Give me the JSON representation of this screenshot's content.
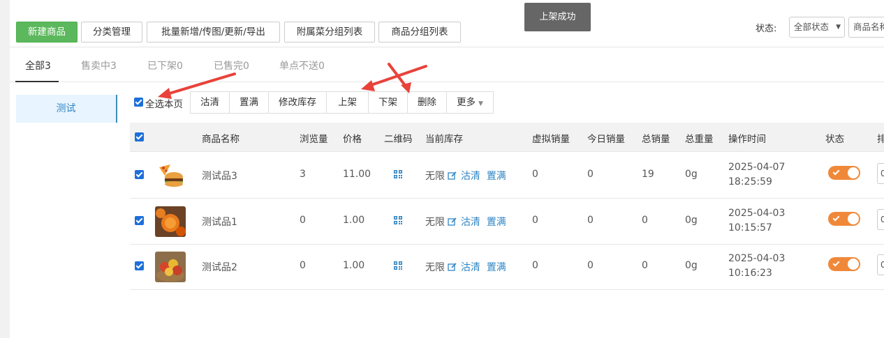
{
  "toolbar": {
    "new_product": "新建商品",
    "category_manage": "分类管理",
    "batch_ops": "批量新增/传图/更新/导出",
    "addon_group_list": "附属菜分组列表",
    "product_group_list": "商品分组列表",
    "status_label": "状态:",
    "status_select": "全部状态",
    "name_select": "商品名称"
  },
  "toast": "上架成功",
  "tabs": [
    {
      "label": "全部3"
    },
    {
      "label": "售卖中3"
    },
    {
      "label": "已下架0"
    },
    {
      "label": "已售完0"
    },
    {
      "label": "单点不送0"
    }
  ],
  "sidebar": {
    "category": "测试"
  },
  "actions": {
    "select_page": "全选本页",
    "items": [
      "沽清",
      "置满",
      "修改库存",
      "上架",
      "下架",
      "删除",
      "更多"
    ]
  },
  "table": {
    "headers": {
      "name": "商品名称",
      "views": "浏览量",
      "price": "价格",
      "qrcode": "二维码",
      "stock": "当前库存",
      "virtual_sales": "虚拟销量",
      "today_sales": "今日销量",
      "total_sales": "总销量",
      "total_weight": "总重量",
      "op_time": "操作时间",
      "status": "状态",
      "sort": "排"
    },
    "stock_text": "无限",
    "clear_link": "沽清",
    "fill_link": "置满",
    "rows": [
      {
        "name": "测试品3",
        "views": "3",
        "price": "11.00",
        "virtual": "0",
        "today": "0",
        "total": "19",
        "weight": "0g",
        "date": "2025-04-07",
        "time": "18:25:59",
        "sort": "0",
        "image": "pizza-burger"
      },
      {
        "name": "测试品1",
        "views": "0",
        "price": "1.00",
        "virtual": "0",
        "today": "0",
        "total": "0",
        "weight": "0g",
        "date": "2025-04-03",
        "time": "10:15:57",
        "sort": "0",
        "image": "oranges"
      },
      {
        "name": "测试品2",
        "views": "0",
        "price": "1.00",
        "virtual": "0",
        "today": "0",
        "total": "0",
        "weight": "0g",
        "date": "2025-04-03",
        "time": "10:16:23",
        "sort": "0",
        "image": "apples-basket"
      }
    ]
  },
  "colors": {
    "primary_green": "#5cb85c",
    "link_blue": "#2f85c4",
    "toggle_orange": "#f0883a",
    "arrow_red": "#e8423a"
  }
}
